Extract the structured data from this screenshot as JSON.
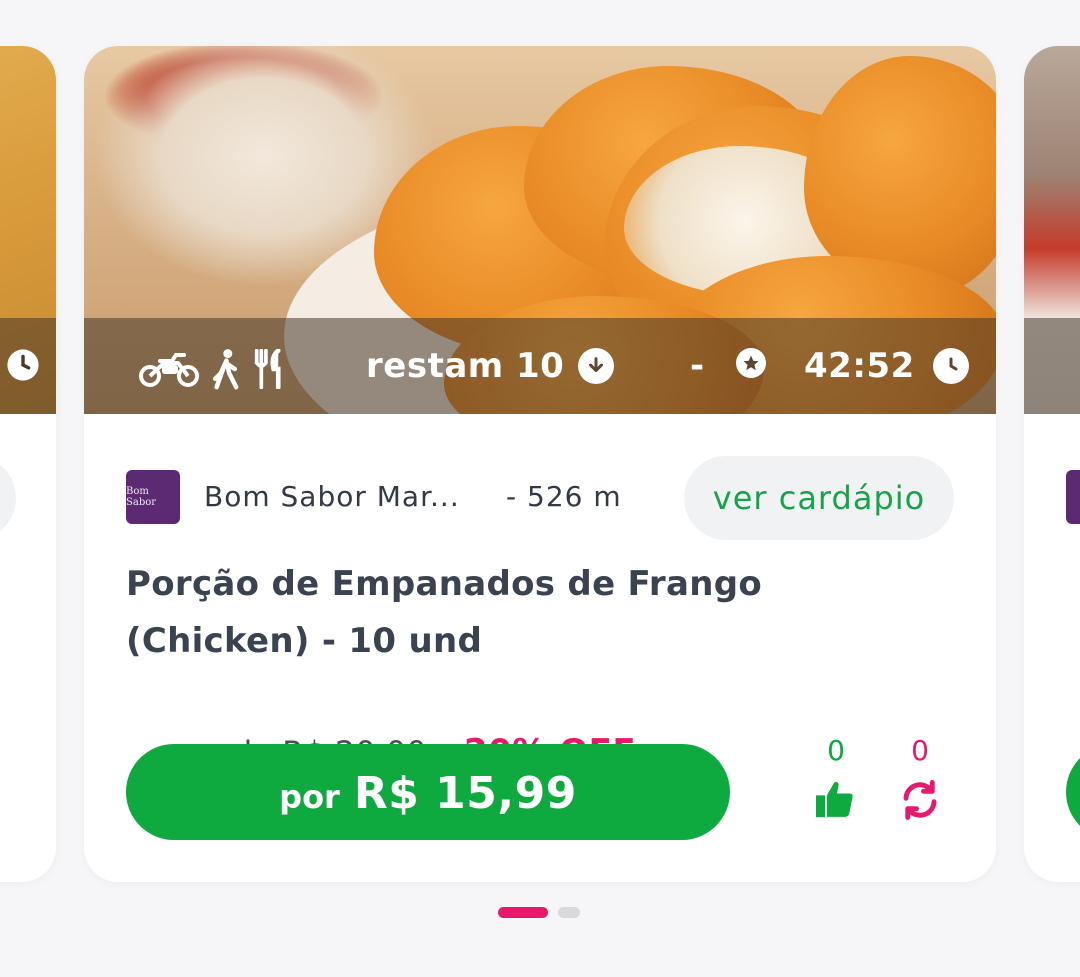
{
  "card": {
    "overlay": {
      "remaining_text": "restam 10",
      "separator": "-",
      "timer": "42:52",
      "icons": [
        "motorcycle-icon",
        "walking-icon",
        "utensils-icon",
        "download-circle-icon",
        "star-circle-icon",
        "clock-icon"
      ]
    },
    "store": {
      "logo_text": "Bom Sabor",
      "name": "Bom Sabor Mar...",
      "distance": "- 526 m",
      "menu_button": "ver cardápio"
    },
    "title": "Porção de Empanados de Frango (Chicken) - 10 und",
    "old_price": "de R$ 20,00",
    "discount": "20% OFF",
    "buy_button": {
      "prefix": "por",
      "price": "R$ 15,99"
    },
    "likes": "0",
    "refreshes": "0"
  },
  "carousel": {
    "total_pages": 2,
    "active_page": 1
  },
  "colors": {
    "accent_green": "#0eaa3f",
    "accent_pink": "#e8196c",
    "text_dark": "#3b4250",
    "store_logo": "#5b2a72"
  }
}
